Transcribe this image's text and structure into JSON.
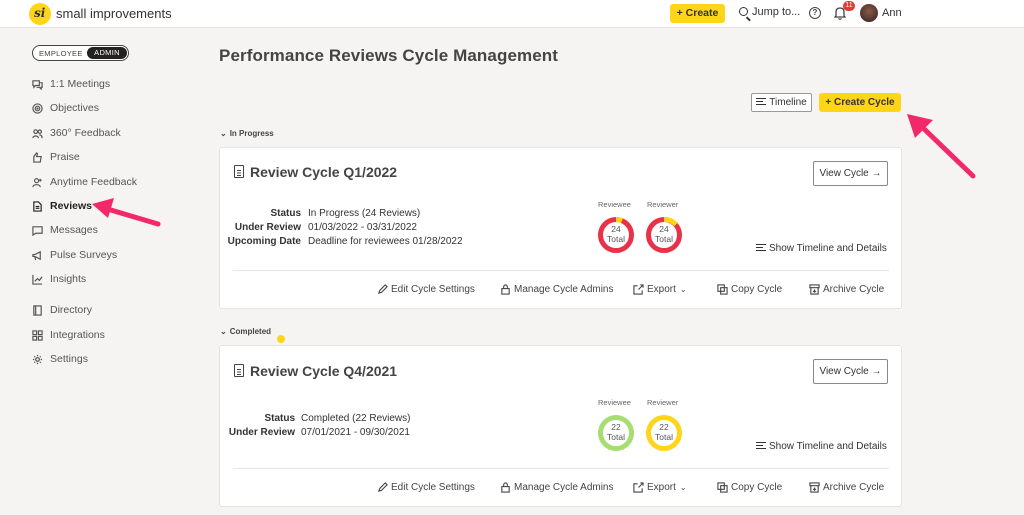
{
  "topbar": {
    "logo_text": "small improvements",
    "create_label": "+ Create",
    "jump_label": "Jump to...",
    "help_icon": "help-circle-icon",
    "notifications_count": "11",
    "user_name": "Ann"
  },
  "sidebar": {
    "role_toggle": {
      "employee": "EMPLOYEE",
      "admin": "ADMIN",
      "selected": "ADMIN"
    },
    "items": [
      {
        "label": "1:1 Meetings",
        "icon": "chat-bubbles-icon"
      },
      {
        "label": "Objectives",
        "icon": "target-icon"
      },
      {
        "label": "360° Feedback",
        "icon": "people-icon"
      },
      {
        "label": "Praise",
        "icon": "praise-icon"
      },
      {
        "label": "Anytime Feedback",
        "icon": "person-plus-icon"
      },
      {
        "label": "Reviews",
        "icon": "document-icon",
        "active": true
      },
      {
        "label": "Messages",
        "icon": "message-icon"
      },
      {
        "label": "Pulse Surveys",
        "icon": "megaphone-icon"
      },
      {
        "label": "Insights",
        "icon": "chart-icon"
      },
      {
        "label": "Directory",
        "icon": "book-icon"
      },
      {
        "label": "Integrations",
        "icon": "grid-icon"
      },
      {
        "label": "Settings",
        "icon": "gear-icon"
      }
    ]
  },
  "main": {
    "title": "Performance Reviews Cycle Management",
    "timeline_button": "Timeline",
    "create_cycle_button": "+ Create Cycle",
    "sections": [
      {
        "label": "In Progress",
        "cycle": {
          "title": "Review Cycle Q1/2022",
          "view_button": "View Cycle →",
          "fields": [
            {
              "key": "Status",
              "value": "In Progress (24 Reviews)"
            },
            {
              "key": "Under Review",
              "value": "01/03/2022 - 03/31/2022"
            },
            {
              "key": "Upcoming Date",
              "value": "Deadline for reviewees 01/28/2022"
            }
          ],
          "reviewee": {
            "label": "Reviewee",
            "count": "24",
            "total_label": "Total",
            "color": "#e8324a",
            "accent": "#ffd51a"
          },
          "reviewer": {
            "label": "Reviewer",
            "count": "24",
            "total_label": "Total",
            "color": "#e8324a",
            "accent": "#ffd51a"
          },
          "show_timeline": "Show Timeline and Details",
          "actions": [
            "Edit Cycle Settings",
            "Manage Cycle Admins",
            "Export",
            "Copy Cycle",
            "Archive Cycle"
          ]
        }
      },
      {
        "label": "Completed",
        "cycle": {
          "title": "Review Cycle Q4/2021",
          "view_button": "View Cycle →",
          "fields": [
            {
              "key": "Status",
              "value": "Completed (22 Reviews)"
            },
            {
              "key": "Under Review",
              "value": "07/01/2021 - 09/30/2021"
            }
          ],
          "reviewee": {
            "label": "Reviewee",
            "count": "22",
            "total_label": "Total",
            "color": "#a8dd74"
          },
          "reviewer": {
            "label": "Reviewer",
            "count": "22",
            "total_label": "Total",
            "color": "#ffd51a"
          },
          "show_timeline": "Show Timeline and Details",
          "actions": [
            "Edit Cycle Settings",
            "Manage Cycle Admins",
            "Export",
            "Copy Cycle",
            "Archive Cycle"
          ]
        }
      }
    ]
  },
  "colors": {
    "brand_yellow": "#ffd51a",
    "annotation_pink": "#f2286b",
    "background": "#f6f4f3"
  }
}
